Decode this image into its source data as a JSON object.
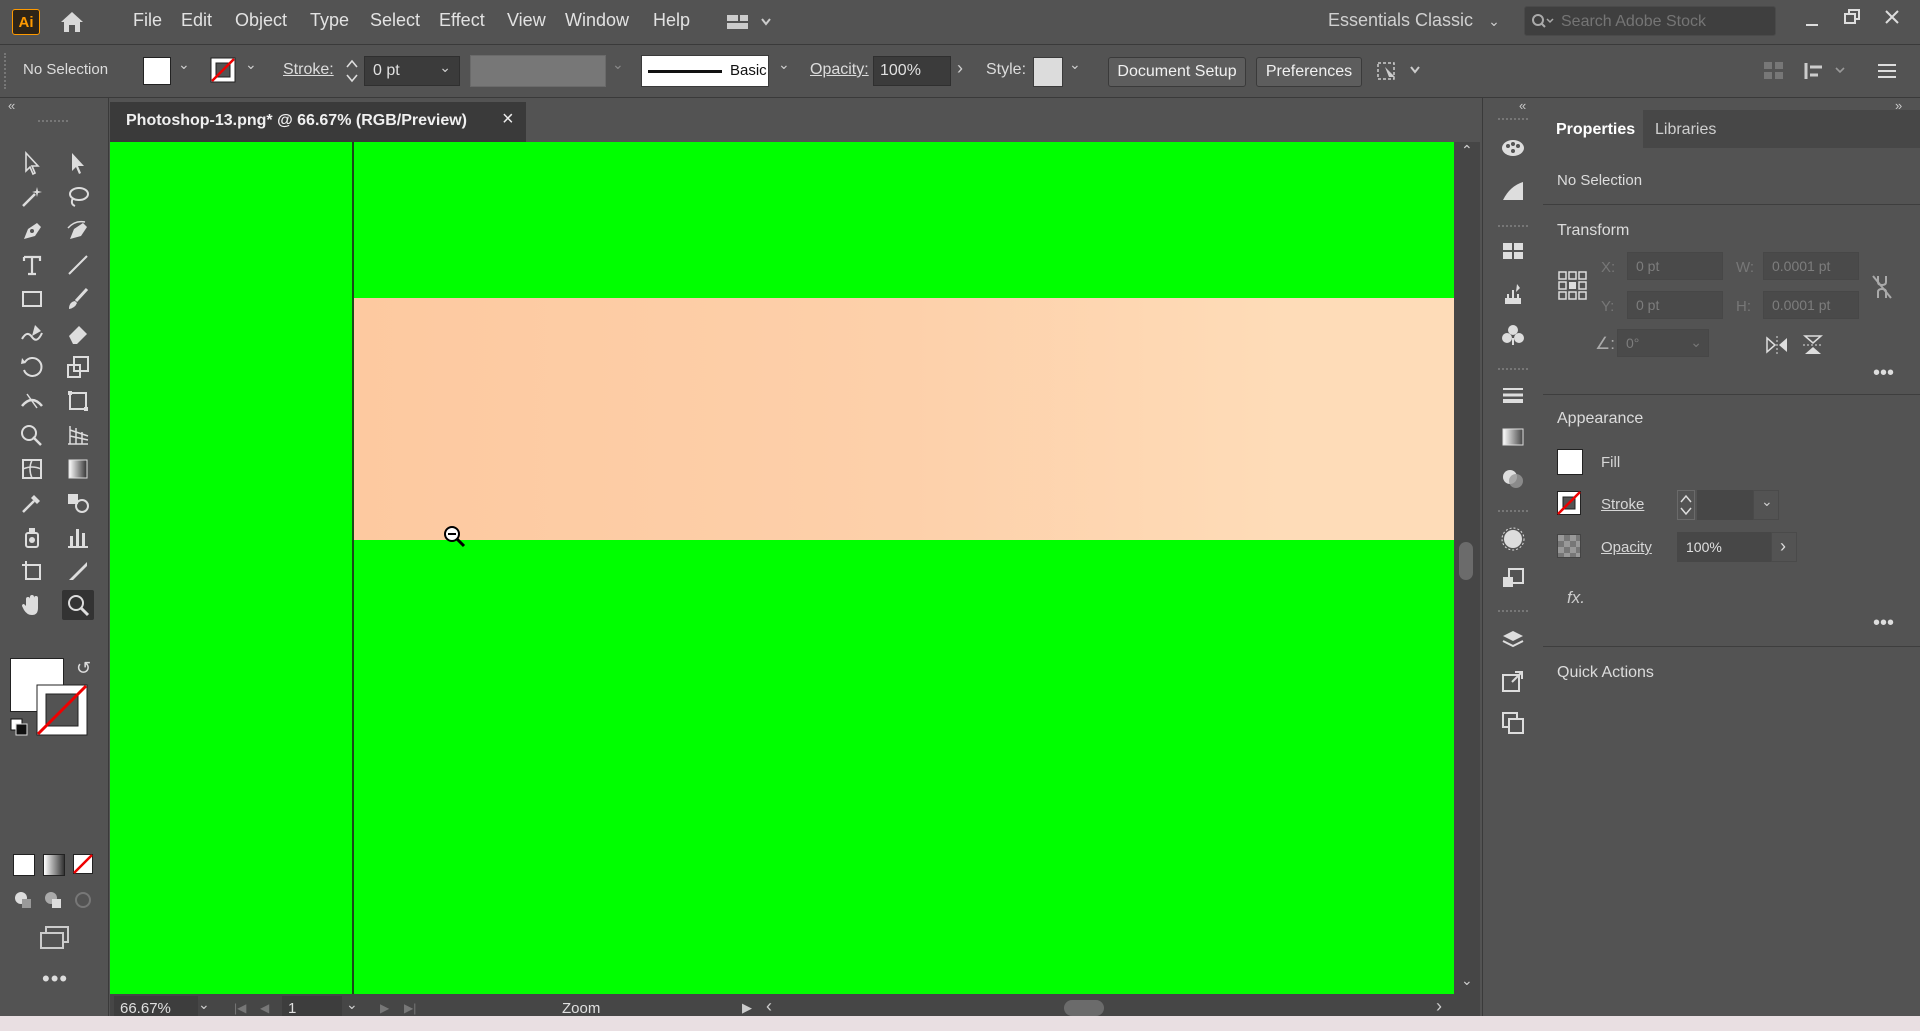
{
  "app": {
    "logo": "Ai"
  },
  "menu": [
    "File",
    "Edit",
    "Object",
    "Type",
    "Select",
    "Effect",
    "View",
    "Window",
    "Help"
  ],
  "workspace": "Essentials Classic",
  "search": {
    "placeholder": "Search Adobe Stock"
  },
  "control_bar": {
    "selection": "No Selection",
    "stroke_label": "Stroke:",
    "stroke_value": "0 pt",
    "brush": "Basic",
    "opacity_label": "Opacity:",
    "opacity_value": "100%",
    "style_label": "Style:",
    "document_setup": "Document Setup",
    "preferences": "Preferences"
  },
  "document": {
    "tab_title": "Photoshop-13.png* @ 66.67% (RGB/Preview)",
    "close": "×",
    "canvas_color": "#00ff00",
    "band_color": "#fdd0aa"
  },
  "status_bar": {
    "zoom": "66.67%",
    "page": "1",
    "tool": "Zoom"
  },
  "properties": {
    "tabs": [
      "Properties",
      "Libraries"
    ],
    "selection": "No Selection",
    "transform": {
      "title": "Transform",
      "x_label": "X:",
      "x": "0 pt",
      "y_label": "Y:",
      "y": "0 pt",
      "w_label": "W:",
      "w": "0.0001 pt",
      "h_label": "H:",
      "h": "0.0001 pt",
      "angle_label": "∠:",
      "angle": "0°"
    },
    "appearance": {
      "title": "Appearance",
      "fill": "Fill",
      "stroke": "Stroke",
      "opacity": "Opacity",
      "opacity_value": "100%",
      "fx": "fx."
    },
    "quick_actions": "Quick Actions"
  }
}
